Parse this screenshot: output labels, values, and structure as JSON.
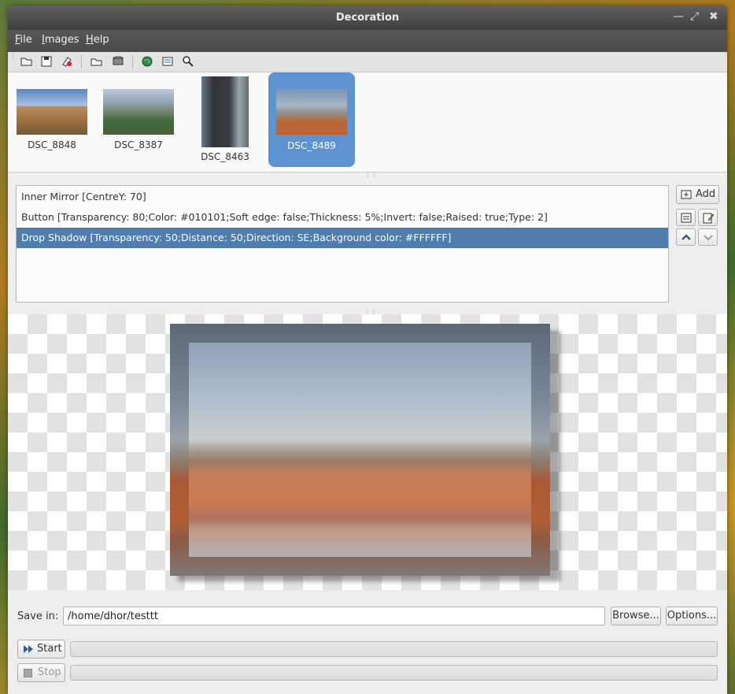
{
  "window": {
    "title": "Decoration"
  },
  "menu": {
    "items": [
      {
        "label": "File",
        "mnemonic": "F",
        "rest": "ile"
      },
      {
        "label": "Images",
        "mnemonic": "I",
        "rest": "mages"
      },
      {
        "label": "Help",
        "mnemonic": "H",
        "rest": "elp"
      }
    ]
  },
  "toolbar": {
    "icons": [
      "open-folder-icon",
      "save-icon",
      "clear-icon",
      "open-image-icon",
      "disk-icon",
      "globe-icon",
      "list-icon",
      "zoom-icon"
    ]
  },
  "thumbnails": [
    {
      "name": "DSC_8848",
      "selected": false
    },
    {
      "name": "DSC_8387",
      "selected": false
    },
    {
      "name": "DSC_8463",
      "selected": false
    },
    {
      "name": "DSC_8489",
      "selected": true
    }
  ],
  "decorations": {
    "items": [
      "Inner Mirror [CentreY: 70]",
      "Button [Transparency: 80;Color: #010101;Soft edge: false;Thickness: 5%;Invert: false;Raised: true;Type: 2]",
      "Drop Shadow [Transparency: 50;Distance: 50;Direction: SE;Background color: #FFFFFF]"
    ],
    "selected_index": 2,
    "add_label": "Add"
  },
  "output": {
    "save_in_label": "Save in:",
    "path": "/home/dhor/testtt",
    "browse_label": "Browse...",
    "options_label": "Options..."
  },
  "actions": {
    "start_label": "Start",
    "stop_label": "Stop",
    "progress_1": 0,
    "progress_2": 0
  },
  "colors": {
    "accent": "#5d93d0",
    "selection": "#4f7eae"
  }
}
